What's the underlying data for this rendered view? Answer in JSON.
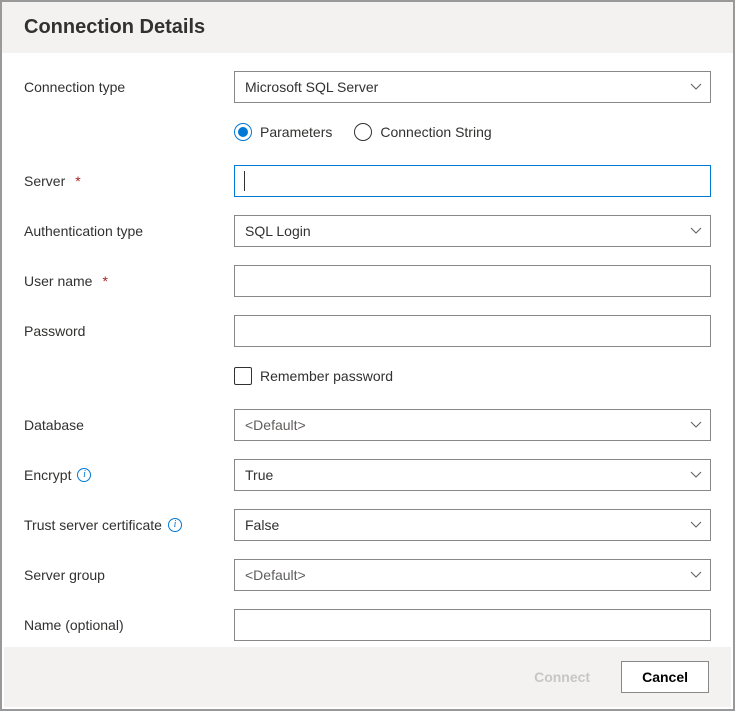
{
  "header": {
    "title": "Connection Details"
  },
  "labels": {
    "connection_type": "Connection type",
    "server": "Server",
    "auth_type": "Authentication type",
    "user_name": "User name",
    "password": "Password",
    "remember_password": "Remember password",
    "database": "Database",
    "encrypt": "Encrypt",
    "trust_cert": "Trust server certificate",
    "server_group": "Server group",
    "name_optional": "Name (optional)"
  },
  "values": {
    "connection_type": "Microsoft SQL Server",
    "server": "",
    "auth_type": "SQL Login",
    "user_name": "",
    "password": "",
    "remember_password": false,
    "database": "<Default>",
    "encrypt": "True",
    "trust_cert": "False",
    "server_group": "<Default>",
    "name_optional": ""
  },
  "input_mode": {
    "options": [
      "Parameters",
      "Connection String"
    ],
    "selected": "Parameters"
  },
  "buttons": {
    "connect": "Connect",
    "cancel": "Cancel"
  }
}
